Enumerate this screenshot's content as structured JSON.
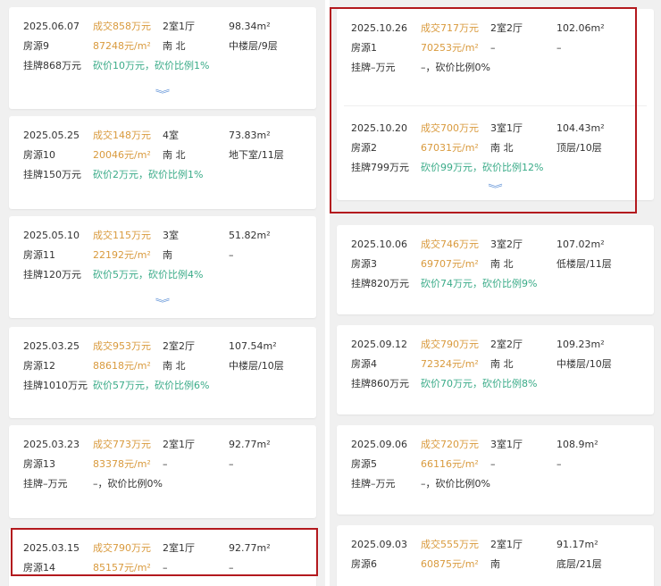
{
  "left": {
    "listings": [
      {
        "date": "2025.06.07",
        "deal": "成交858万元",
        "layout": "2室1厅",
        "area": "98.34m²",
        "source": "房源9",
        "unit_price": "87248元/m²",
        "orientation": "南 北",
        "floor": "中楼层/9层",
        "listed": "挂牌868万元",
        "cut": "砍价10万元，砍价比例1%"
      },
      {
        "date": "2025.05.25",
        "deal": "成交148万元",
        "layout": "4室",
        "area": "73.83m²",
        "source": "房源10",
        "unit_price": "20046元/m²",
        "orientation": "南 北",
        "floor": "地下室/11层",
        "listed": "挂牌150万元",
        "cut": "砍价2万元，砍价比例1%"
      },
      {
        "date": "2025.05.10",
        "deal": "成交115万元",
        "layout": "3室",
        "area": "51.82m²",
        "source": "房源11",
        "unit_price": "22192元/m²",
        "orientation": "南",
        "floor": "–",
        "listed": "挂牌120万元",
        "cut": "砍价5万元，砍价比例4%"
      },
      {
        "date": "2025.03.25",
        "deal": "成交953万元",
        "layout": "2室2厅",
        "area": "107.54m²",
        "source": "房源12",
        "unit_price": "88618元/m²",
        "orientation": "南 北",
        "floor": "中楼层/10层",
        "listed": "挂牌1010万元",
        "cut": "砍价57万元，砍价比例6%"
      },
      {
        "date": "2025.03.23",
        "deal": "成交773万元",
        "layout": "2室1厅",
        "area": "92.77m²",
        "source": "房源13",
        "unit_price": "83378元/m²",
        "orientation": "–",
        "floor": "–",
        "listed": "挂牌–万元",
        "cut": "–，砍价比例0%"
      },
      {
        "date": "2025.03.15",
        "deal": "成交790万元",
        "layout": "2室1厅",
        "area": "92.77m²",
        "source": "房源14",
        "unit_price": "85157元/m²",
        "orientation": "–",
        "floor": "–"
      }
    ],
    "expand_icon": "double-chevron-down-icon"
  },
  "right": {
    "listings": [
      {
        "date": "2025.10.26",
        "deal": "成交717万元",
        "layout": "2室2厅",
        "area": "102.06m²",
        "source": "房源1",
        "unit_price": "70253元/m²",
        "orientation": "–",
        "floor": "–",
        "listed": "挂牌–万元",
        "cut": "–，砍价比例0%"
      },
      {
        "date": "2025.10.20",
        "deal": "成交700万元",
        "layout": "3室1厅",
        "area": "104.43m²",
        "source": "房源2",
        "unit_price": "67031元/m²",
        "orientation": "南 北",
        "floor": "顶层/10层",
        "listed": "挂牌799万元",
        "cut": "砍价99万元，砍价比例12%"
      },
      {
        "date": "2025.10.06",
        "deal": "成交746万元",
        "layout": "3室2厅",
        "area": "107.02m²",
        "source": "房源3",
        "unit_price": "69707元/m²",
        "orientation": "南 北",
        "floor": "低楼层/11层",
        "listed": "挂牌820万元",
        "cut": "砍价74万元，砍价比例9%"
      },
      {
        "date": "2025.09.12",
        "deal": "成交790万元",
        "layout": "2室2厅",
        "area": "109.23m²",
        "source": "房源4",
        "unit_price": "72324元/m²",
        "orientation": "南 北",
        "floor": "中楼层/10层",
        "listed": "挂牌860万元",
        "cut": "砍价70万元，砍价比例8%"
      },
      {
        "date": "2025.09.06",
        "deal": "成交720万元",
        "layout": "3室1厅",
        "area": "108.9m²",
        "source": "房源5",
        "unit_price": "66116元/m²",
        "orientation": "–",
        "floor": "–",
        "listed": "挂牌–万元",
        "cut": "–，砍价比例0%"
      },
      {
        "date": "2025.09.03",
        "deal": "成交555万元",
        "layout": "2室1厅",
        "area": "91.17m²",
        "source": "房源6",
        "unit_price": "60875元/m²",
        "orientation": "南",
        "floor": "底层/21层"
      }
    ],
    "expand_icon": "double-chevron-down-icon"
  },
  "colors": {
    "deal": "#d99a3d",
    "cut": "#3aab88",
    "highlight": "#b3191e",
    "chevron": "#5b8fd6"
  }
}
